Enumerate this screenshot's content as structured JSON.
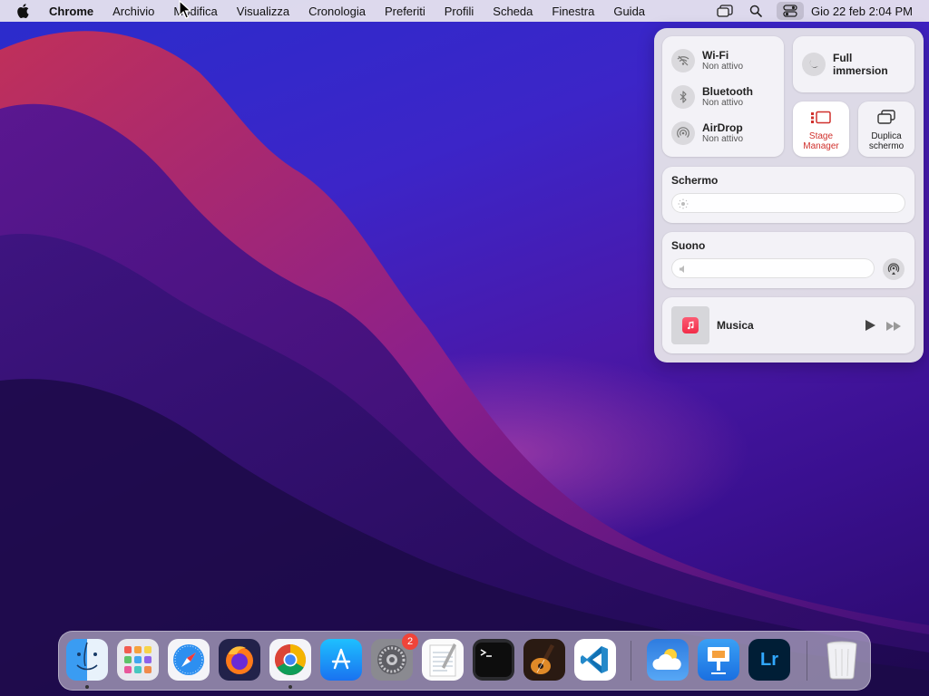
{
  "menubar": {
    "app_name": "Chrome",
    "items": [
      "Archivio",
      "Modifica",
      "Visualizza",
      "Cronologia",
      "Preferiti",
      "Profili",
      "Scheda",
      "Finestra",
      "Guida"
    ],
    "clock": "Gio 22 feb  2:04 PM"
  },
  "control_center": {
    "wifi": {
      "title": "Wi-Fi",
      "status": "Non attivo"
    },
    "bluetooth": {
      "title": "Bluetooth",
      "status": "Non attivo"
    },
    "airdrop": {
      "title": "AirDrop",
      "status": "Non attivo"
    },
    "focus": {
      "label": "Full immersion"
    },
    "stage_manager": {
      "label_line1": "Stage",
      "label_line2": "Manager",
      "active": true,
      "accent": "#d0312d"
    },
    "screen_mirroring": {
      "label_line1": "Duplica",
      "label_line2": "schermo"
    },
    "display": {
      "title": "Schermo",
      "level": 0.0
    },
    "sound": {
      "title": "Suono",
      "level": 0.0
    },
    "now_playing": {
      "title": "Musica"
    }
  },
  "dock": {
    "apps": [
      {
        "name": "Finder",
        "icon": "finder-icon",
        "running": true
      },
      {
        "name": "Launchpad",
        "icon": "launchpad-icon",
        "running": false
      },
      {
        "name": "Safari",
        "icon": "safari-icon",
        "running": false
      },
      {
        "name": "Firefox",
        "icon": "firefox-icon",
        "running": false
      },
      {
        "name": "Chrome",
        "icon": "chrome-icon",
        "running": true
      },
      {
        "name": "App Store",
        "icon": "app-store-icon",
        "running": false
      },
      {
        "name": "Impostazioni di sistema",
        "icon": "system-settings-icon",
        "running": false,
        "badge": "2"
      },
      {
        "name": "TextEdit",
        "icon": "textedit-icon",
        "running": false
      },
      {
        "name": "Terminale",
        "icon": "terminal-icon",
        "running": false
      },
      {
        "name": "GarageBand",
        "icon": "garageband-icon",
        "running": false
      },
      {
        "name": "Visual Studio Code",
        "icon": "vscode-icon",
        "running": false
      },
      {
        "name": "Meteo",
        "icon": "weather-icon",
        "running": false
      },
      {
        "name": "Keynote",
        "icon": "keynote-icon",
        "running": false
      },
      {
        "name": "Lightroom",
        "icon": "lightroom-icon",
        "running": false
      },
      {
        "name": "Cestino",
        "icon": "trash-icon",
        "running": false
      }
    ],
    "lightroom_label": "Lr"
  }
}
